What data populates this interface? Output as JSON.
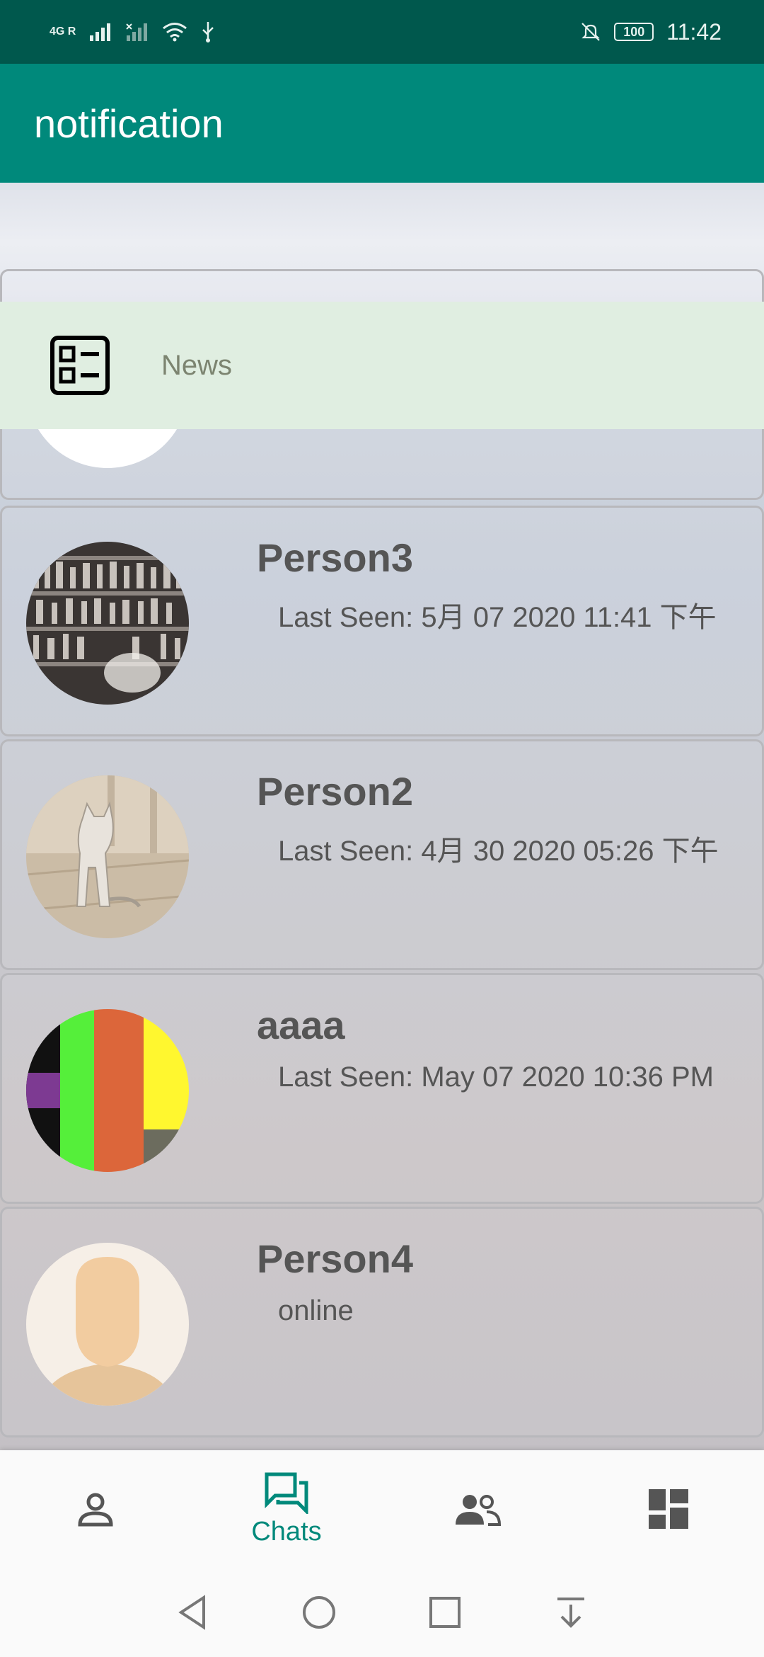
{
  "status_bar": {
    "network_label": "4G R",
    "battery": "100",
    "time": "11:42"
  },
  "app_bar": {
    "title": "notification"
  },
  "news": {
    "label": "News"
  },
  "contacts": [
    {
      "name": "Person3",
      "status": "Last Seen: 5月 07 2020 11:41 下午",
      "avatar": "shelves-photo"
    },
    {
      "name": "Person2",
      "status": "Last Seen: 4月 30 2020 05:26 下午",
      "avatar": "cat-statue-photo"
    },
    {
      "name": "aaaa",
      "status": "Last Seen: May 07 2020 10:36 PM",
      "avatar": "color-stripes"
    },
    {
      "name": "Person4",
      "status": "online",
      "avatar": "default-person"
    }
  ],
  "bottom_nav": {
    "items": [
      {
        "icon": "profile-icon",
        "label": ""
      },
      {
        "icon": "chats-icon",
        "label": "Chats"
      },
      {
        "icon": "friends-icon",
        "label": ""
      },
      {
        "icon": "dashboard-icon",
        "label": ""
      }
    ]
  },
  "colors": {
    "status_bar": "#00584d",
    "app_bar": "#00897b",
    "accent": "#00897b",
    "news_bg": "#e0eee1"
  }
}
